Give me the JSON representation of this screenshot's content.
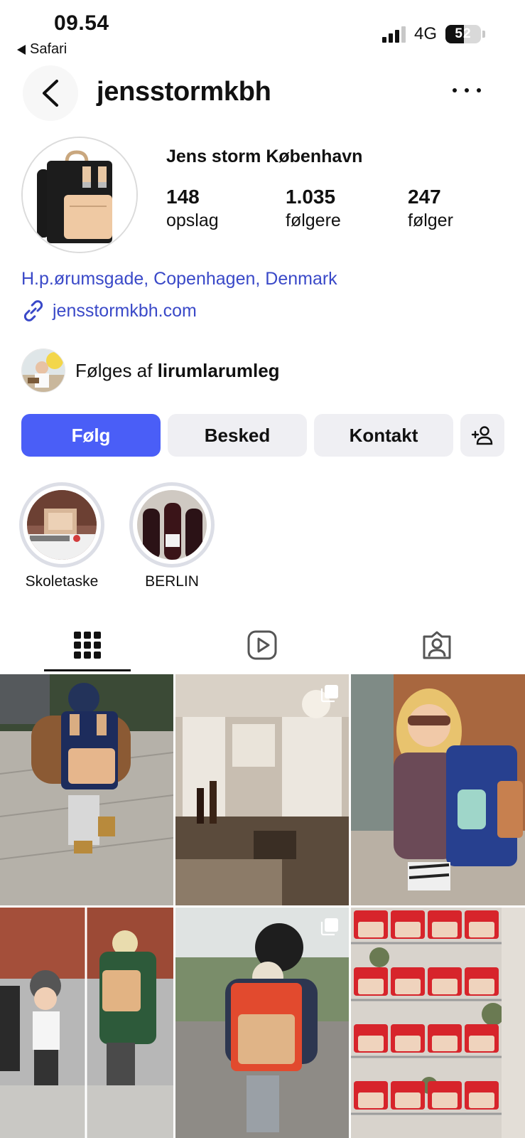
{
  "status_bar": {
    "time": "09.54",
    "back_app": "Safari",
    "network": "4G",
    "battery": "52",
    "battery_level": 0.52
  },
  "header": {
    "username": "jensstormkbh",
    "icons": {
      "back": "chevron-left-icon",
      "more": "more-dots-icon"
    }
  },
  "profile": {
    "display_name": "Jens storm København",
    "stats": [
      {
        "value": "148",
        "label": "opslag"
      },
      {
        "value": "1.035",
        "label": "følgere"
      },
      {
        "value": "247",
        "label": "følger"
      }
    ],
    "location": "H.p.ørumsgade, Copenhagen, Denmark",
    "website": "jensstormkbh.com",
    "followed_by_prefix": "Følges af",
    "followed_by_user": "lirumlarumleg"
  },
  "actions": {
    "follow": "Følg",
    "message": "Besked",
    "contact": "Kontakt"
  },
  "highlights": [
    {
      "label": "Skoletaske"
    },
    {
      "label": "BERLIN"
    }
  ],
  "tabs": [
    {
      "icon": "grid-icon",
      "active": true
    },
    {
      "icon": "reels-icon",
      "active": false
    },
    {
      "icon": "tagged-icon",
      "active": false
    }
  ],
  "posts": [
    {
      "type": "photo",
      "multi": false
    },
    {
      "type": "photo",
      "multi": true
    },
    {
      "type": "photo",
      "multi": false
    },
    {
      "type": "photo",
      "multi": false
    },
    {
      "type": "photo",
      "multi": true
    },
    {
      "type": "photo",
      "multi": false
    }
  ],
  "colors": {
    "accent": "#4a5ef7",
    "link": "#3a49c8",
    "secondary_button": "#efeff3"
  }
}
